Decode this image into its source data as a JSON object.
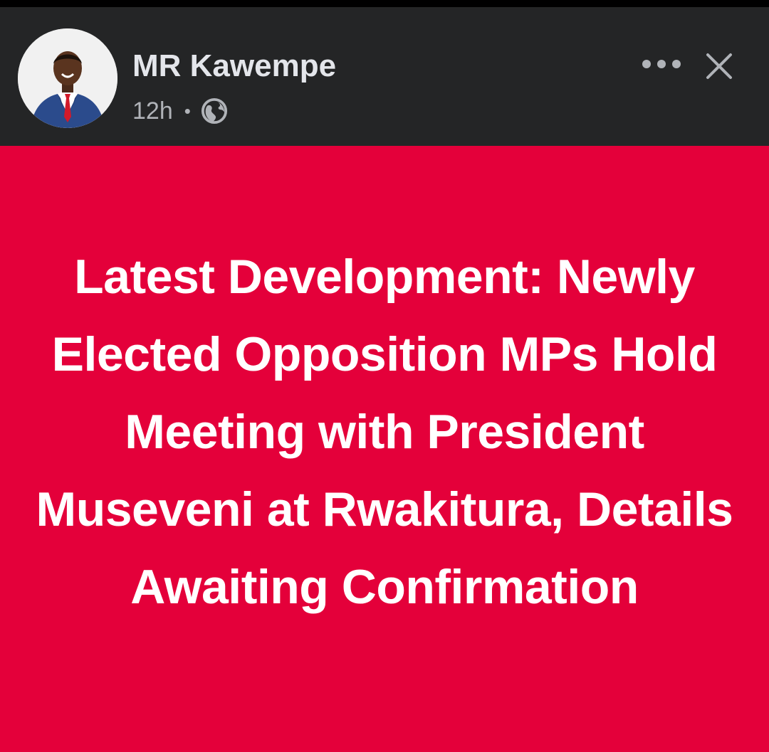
{
  "post": {
    "author": "MR Kawempe",
    "time": "12h",
    "separator": "•",
    "audience_icon": "globe-icon",
    "headline": "Latest Development: Newly Elected Opposition MPs Hold Meeting with President Museveni at Rwakitura, Details Awaiting Confirmation"
  },
  "actions": {
    "more_icon": "more-options-icon",
    "close_icon": "close-icon"
  },
  "colors": {
    "header_bg": "#242526",
    "post_bg": "#e4003a",
    "headline_text": "#ffffff",
    "name_text": "#e4e6eb",
    "meta_text": "#b0b3b8"
  }
}
